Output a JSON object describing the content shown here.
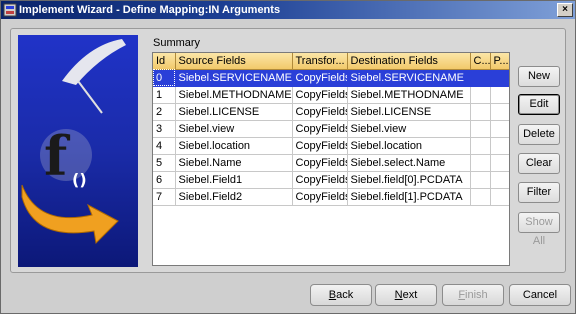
{
  "window": {
    "title": "Implement Wizard - Define Mapping:IN Arguments",
    "close_glyph": "×"
  },
  "summary": {
    "label": "Summary",
    "columns": [
      "Id",
      "Source Fields",
      "Transfor...",
      "Destination Fields",
      "C...",
      "P..."
    ],
    "rows": [
      {
        "id": "0",
        "source": "Siebel.SERVICENAME",
        "transform": "CopyFields",
        "destination": "Siebel.SERVICENAME",
        "c": "",
        "p": "",
        "selected": true
      },
      {
        "id": "1",
        "source": "Siebel.METHODNAME",
        "transform": "CopyFields",
        "destination": "Siebel.METHODNAME",
        "c": "",
        "p": "",
        "selected": false
      },
      {
        "id": "2",
        "source": "Siebel.LICENSE",
        "transform": "CopyFields",
        "destination": "Siebel.LICENSE",
        "c": "",
        "p": "",
        "selected": false
      },
      {
        "id": "3",
        "source": "Siebel.view",
        "transform": "CopyFields",
        "destination": "Siebel.view",
        "c": "",
        "p": "",
        "selected": false
      },
      {
        "id": "4",
        "source": "Siebel.location",
        "transform": "CopyFields",
        "destination": "Siebel.location",
        "c": "",
        "p": "",
        "selected": false
      },
      {
        "id": "5",
        "source": "Siebel.Name",
        "transform": "CopyFields",
        "destination": "Siebel.select.Name",
        "c": "",
        "p": "",
        "selected": false
      },
      {
        "id": "6",
        "source": "Siebel.Field1",
        "transform": "CopyFields",
        "destination": "Siebel.field[0].PCDATA",
        "c": "",
        "p": "",
        "selected": false
      },
      {
        "id": "7",
        "source": "Siebel.Field2",
        "transform": "CopyFields",
        "destination": "Siebel.field[1].PCDATA",
        "c": "",
        "p": "",
        "selected": false
      }
    ]
  },
  "side_buttons": {
    "new": "New",
    "edit": "Edit",
    "delete": "Delete",
    "clear": "Clear",
    "filter": "Filter",
    "show_all": "Show All"
  },
  "footer": {
    "back_mnemonic": "B",
    "back_rest": "ack",
    "next_mnemonic": "N",
    "next_rest": "ext",
    "finish_mnemonic": "F",
    "finish_rest": "inish",
    "cancel": "Cancel"
  },
  "illustration": {
    "glyph_f": "f",
    "glyph_parens": "()"
  },
  "colors": {
    "titlebar": "#0a246a",
    "selection": "#2a3fd8",
    "header": "#f2c96a",
    "banner": "#1a2ba8"
  }
}
